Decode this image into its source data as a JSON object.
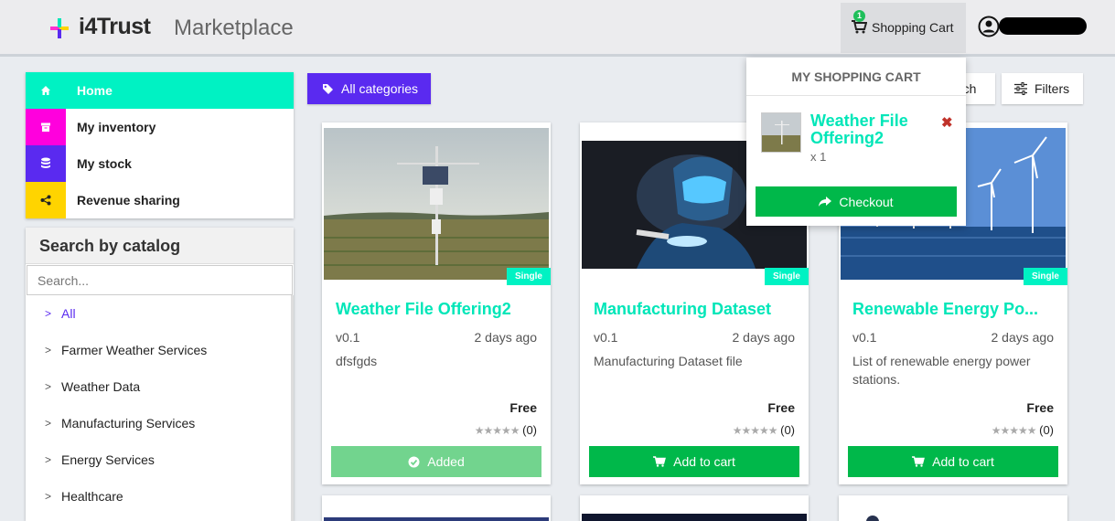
{
  "header": {
    "brand": "i4Trust",
    "app_name": "Marketplace",
    "cart_label": "Shopping Cart",
    "cart_count": "1",
    "user_name_redacted": true
  },
  "sidebar": {
    "items": [
      {
        "label": "Home",
        "icon": "home-icon",
        "color": "#00f2c3",
        "active": true
      },
      {
        "label": "My inventory",
        "icon": "archive-icon",
        "color": "#ff00dd"
      },
      {
        "label": "My stock",
        "icon": "database-icon",
        "color": "#5a2af0"
      },
      {
        "label": "Revenue sharing",
        "icon": "share-icon",
        "color": "#ffd400"
      }
    ]
  },
  "catalog": {
    "title": "Search by catalog",
    "search_placeholder": "Search...",
    "items": [
      "All",
      "Farmer Weather Services",
      "Weather Data",
      "Manufacturing Services",
      "Energy Services",
      "Healthcare"
    ]
  },
  "toolbar": {
    "all_categories": "All categories",
    "search_label": "rch",
    "filters_label": "Filters"
  },
  "cards": [
    {
      "title": "Weather File Offering2",
      "version": "v0.1",
      "ago": "2 days ago",
      "desc": "dfsfgds",
      "price": "Free",
      "rating": "(0)",
      "badge": "Single",
      "button": "Added"
    },
    {
      "title": "Manufacturing Dataset",
      "version": "v0.1",
      "ago": "2 days ago",
      "desc": "Manufacturing Dataset file",
      "price": "Free",
      "rating": "(0)",
      "badge": "Single",
      "button": "Add to cart"
    },
    {
      "title": "Renewable Energy Po...",
      "version": "v0.1",
      "ago": "2 days ago",
      "desc": "List of renewable energy power stations.",
      "price": "Free",
      "rating": "(0)",
      "badge": "Single",
      "button": "Add to cart"
    }
  ],
  "cart_popup": {
    "title": "MY SHOPPING CART",
    "item_name": "Weather File Offering2",
    "quantity": "x 1",
    "checkout": "Checkout"
  },
  "colors": {
    "accent_teal": "#00f2c3",
    "accent_purple": "#5a2af0",
    "success_green": "#00b84a"
  }
}
